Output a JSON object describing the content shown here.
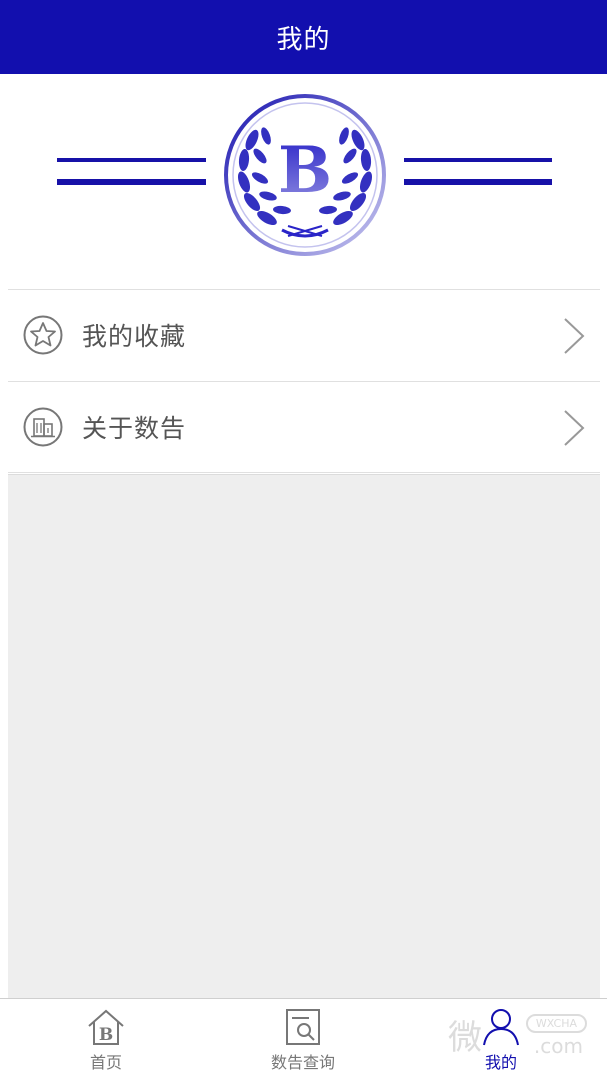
{
  "header": {
    "title": "我的"
  },
  "emblem": {
    "letter": "B"
  },
  "menu": [
    {
      "label": "我的收藏",
      "icon": "star-icon"
    },
    {
      "label": "关于数告",
      "icon": "building-icon"
    }
  ],
  "tabbar": {
    "items": [
      {
        "label": "首页",
        "icon": "home-icon",
        "active": false
      },
      {
        "label": "数告查询",
        "icon": "search-document-icon",
        "active": false
      },
      {
        "label": "我的",
        "icon": "user-icon",
        "active": true
      }
    ]
  },
  "watermark": {
    "text": "微",
    "badge": "WXCHA",
    "suffix": ".com"
  },
  "colors": {
    "accent": "#120fae",
    "background_gray": "#eeeeee"
  }
}
